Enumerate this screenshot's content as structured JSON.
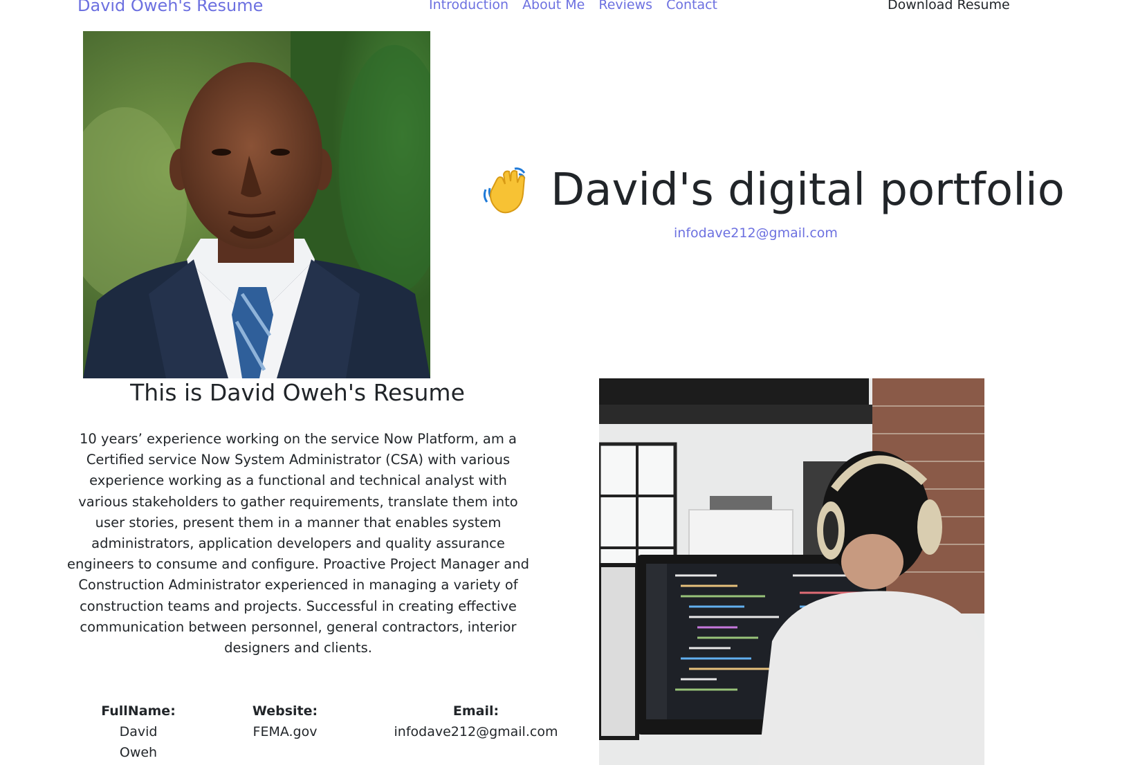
{
  "navbar": {
    "brand": "David Oweh's Resume",
    "links": [
      "Introduction",
      "About Me",
      "Reviews",
      "Contact"
    ],
    "download": "Download Resume"
  },
  "hero": {
    "title": "David's digital portfolio",
    "icon": "waving-hand-icon",
    "email": "infodave212@gmail.com"
  },
  "resume": {
    "title": "This is David Oweh's Resume",
    "body": "10 years’ experience working on the service Now Platform, am a Certified service Now System Administrator (CSA) with various experience working as a functional and technical analyst with various stakeholders to gather requirements, translate them into user stories, present them in a manner that enables system administrators, application developers and quality assurance engineers to consume and configure. Proactive Project Manager and Construction Administrator experienced in managing a variety of construction teams and projects. Successful in creating effective communication between personnel, general contractors, interior designers and clients."
  },
  "info": {
    "fullname_label": "FullName:",
    "fullname_value_1": "David",
    "fullname_value_2": "Oweh",
    "website_label": "Website:",
    "website_value": "FEMA.gov",
    "email_label": "Email:",
    "email_value": "infodave212@gmail.com"
  },
  "images": {
    "portrait": "portrait-photo",
    "workspace": "developer-workspace-photo"
  },
  "colors": {
    "link": "#6c70e0",
    "text": "#212529",
    "background": "#ffffff"
  }
}
